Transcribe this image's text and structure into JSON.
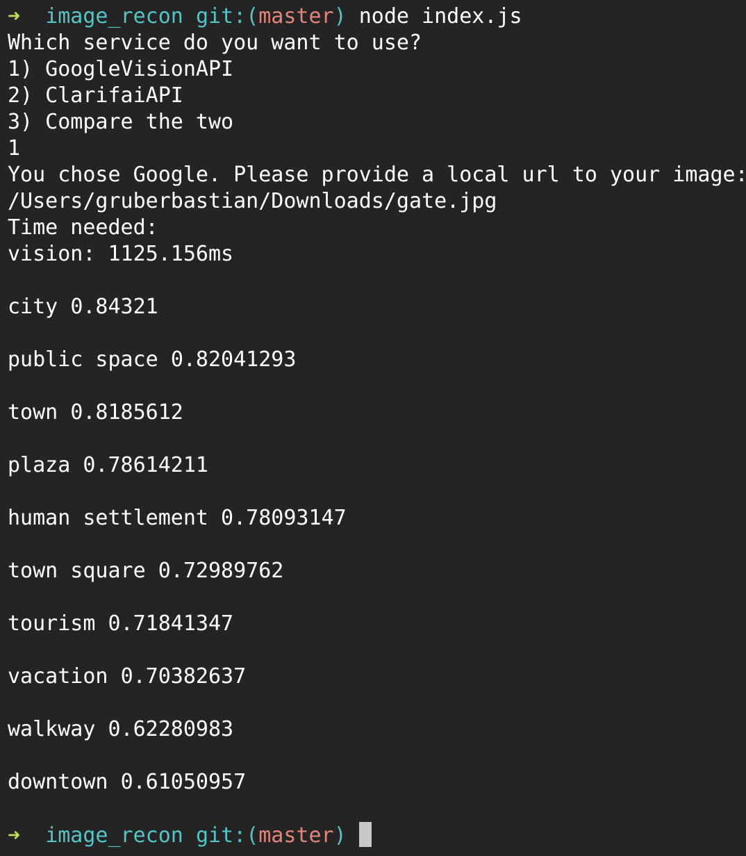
{
  "colors": {
    "background": "#242424",
    "text": "#ffffff",
    "prompt_arrow": "#b8e04f",
    "prompt_dir": "#54c4c5",
    "prompt_branch": "#e2867a",
    "cursor": "#c8c8c8"
  },
  "prompt": {
    "arrow": "➜",
    "dir": "image_recon",
    "git_label": "git:",
    "open_paren": "(",
    "branch": "master",
    "close_paren": ")",
    "command": "node index.js"
  },
  "output": {
    "question": "Which service do you want to use?",
    "options": [
      "1) GoogleVisionAPI",
      "2) ClarifaiAPI",
      "3) Compare the two"
    ],
    "choice": "1",
    "chose_message": "You chose Google. Please provide a local url to your image:",
    "image_path": "/Users/gruberbastian/Downloads/gate.jpg",
    "time_header": "Time needed:",
    "timing": "vision: 1125.156ms"
  },
  "labels": [
    {
      "name": "city",
      "score": "0.84321"
    },
    {
      "name": "public space",
      "score": "0.82041293"
    },
    {
      "name": "town",
      "score": "0.8185612"
    },
    {
      "name": "plaza",
      "score": "0.78614211"
    },
    {
      "name": "human settlement",
      "score": "0.78093147"
    },
    {
      "name": "town square",
      "score": "0.72989762"
    },
    {
      "name": "tourism",
      "score": "0.71841347"
    },
    {
      "name": "vacation",
      "score": "0.70382637"
    },
    {
      "name": "walkway",
      "score": "0.62280983"
    },
    {
      "name": "downtown",
      "score": "0.61050957"
    }
  ]
}
